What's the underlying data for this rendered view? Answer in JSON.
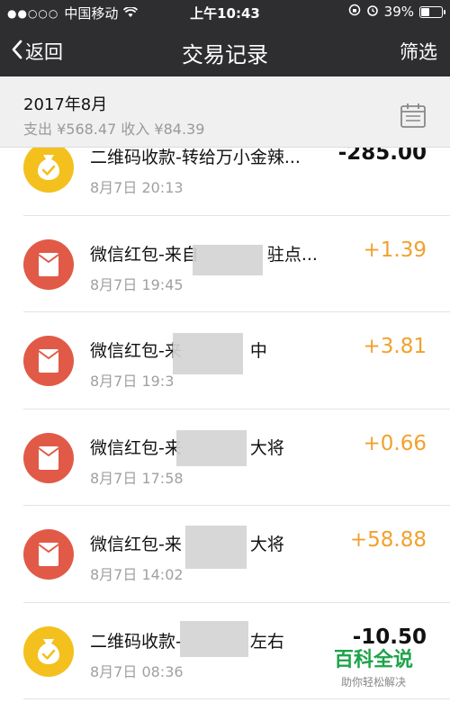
{
  "status_bar": {
    "signal": "●●○○○",
    "carrier": "中国移动",
    "time": "上午10:43",
    "battery": "39%",
    "battery_level": 0.39
  },
  "navbar": {
    "back_label": "返回",
    "title": "交易记录",
    "filter_label": "筛选"
  },
  "summary": {
    "month": "2017年8月",
    "totals": "支出 ¥568.47 收入 ¥84.39"
  },
  "transactions": [
    {
      "type": "qr",
      "desc": "二维码收款-转给万小金辣...",
      "time": "8月7日 20:13",
      "amount": "-285.00"
    },
    {
      "type": "hongbao",
      "desc": "微信红包-来自　　　　驻点...",
      "time": "8月7日 19:45",
      "amount": "+1.39"
    },
    {
      "type": "hongbao",
      "desc": "微信红包-来　　　　中",
      "time": "8月7日 19:3",
      "amount": "+3.81"
    },
    {
      "type": "hongbao",
      "desc": "微信红包-来　　　　大将",
      "time": "8月7日 17:58",
      "amount": "+0.66"
    },
    {
      "type": "hongbao",
      "desc": "微信红包-来　　　　大将",
      "time": "8月7日 14:02",
      "amount": "+58.88"
    },
    {
      "type": "qr",
      "desc": "二维码收款-　　　　左右",
      "time": "8月7日 08:36",
      "amount": "-10.50"
    }
  ],
  "watermark": {
    "main": "百科全说",
    "sub": "助你轻松解决"
  },
  "colors": {
    "bar": "#2e2e30",
    "hongbao": "#e15a47",
    "qr": "#f3c01d",
    "income": "#f1a12c"
  }
}
